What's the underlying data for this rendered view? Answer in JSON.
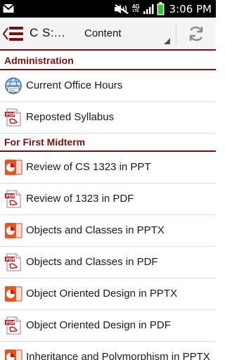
{
  "status_bar": {
    "time": "3:06 PM",
    "network": "4G",
    "network_sub": "LTE",
    "icons": [
      "gmail-icon",
      "no-sound-icon",
      "network-4g-icon",
      "signal-icon",
      "battery-icon"
    ]
  },
  "action_bar": {
    "title": "C S:...",
    "spinner_label": "Content",
    "icons": [
      "back-icon",
      "app-icon",
      "refresh-icon"
    ]
  },
  "sections": [
    {
      "header": "Administration",
      "items": [
        {
          "label": "Current Office Hours",
          "icon": "globe-icon"
        },
        {
          "label": "Reposted Syllabus",
          "icon": "pdf-icon"
        }
      ]
    },
    {
      "header": "For First Midterm",
      "items": [
        {
          "label": "Review of CS 1323 in PPT",
          "icon": "ppt-icon"
        },
        {
          "label": "Review of 1323 in PDF",
          "icon": "pdf-icon"
        },
        {
          "label": "Objects and Classes in PPTX",
          "icon": "ppt-icon"
        },
        {
          "label": "Objects and Classes in PDF",
          "icon": "pdf-icon"
        },
        {
          "label": "Object Oriented Design in PPTX",
          "icon": "ppt-icon"
        },
        {
          "label": "Object Oriented Design in PDF",
          "icon": "pdf-icon"
        },
        {
          "label": "Inheritance and Polymorphism in PPTX",
          "icon": "ppt-icon"
        }
      ]
    }
  ],
  "colors": {
    "accent": "#7a1111",
    "ppt_orange": "#e8561c",
    "pdf_red": "#c8161d"
  }
}
